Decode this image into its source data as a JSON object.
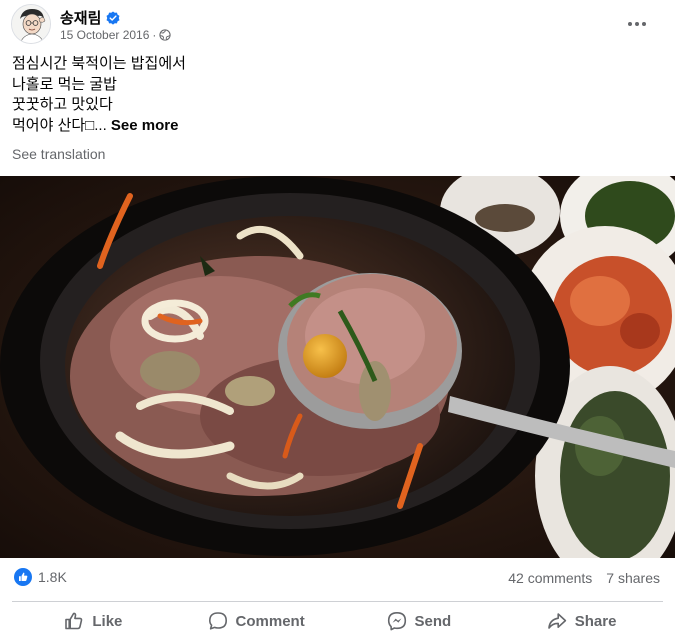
{
  "post": {
    "author": "송재림",
    "date": "15 October 2016",
    "separator": " · ",
    "text_lines": [
      "점심시간 북적이는 밥집에서",
      "나홀로 먹는 굴밥",
      "꿋꿋하고 맛있다",
      "먹어야 산다□..."
    ],
    "see_more": "See more",
    "see_translation": "See translation"
  },
  "icons": {
    "verified": "verified-badge-icon",
    "privacy": "globe-icon",
    "options": "more-options-icon",
    "reaction": "like-reaction-icon",
    "like": "thumbs-up-icon",
    "comment": "comment-bubble-icon",
    "send": "messenger-send-icon",
    "share": "share-arrow-icon"
  },
  "stats": {
    "reactions": "1.8K",
    "comments": "42 comments",
    "shares": "7 shares"
  },
  "actions": {
    "like": "Like",
    "comment": "Comment",
    "send": "Send",
    "share": "Share"
  },
  "colors": {
    "brand_blue": "#1877f2",
    "secondary_text": "#65676b",
    "divider": "#ced0d4"
  }
}
